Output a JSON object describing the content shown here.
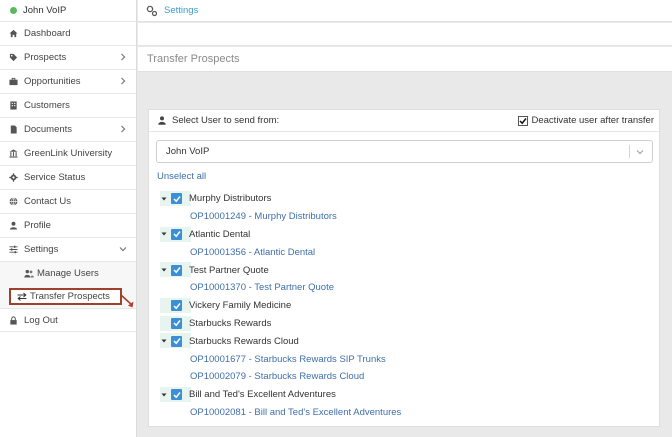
{
  "sidebar": {
    "user_name": "John VoIP",
    "status_color": "#5cb85c",
    "items": [
      {
        "label": "Dashboard",
        "icon": "home-icon"
      },
      {
        "label": "Prospects",
        "icon": "tag-icon",
        "chevron": "right"
      },
      {
        "label": "Opportunities",
        "icon": "briefcase-icon",
        "chevron": "right"
      },
      {
        "label": "Customers",
        "icon": "building-icon"
      },
      {
        "label": "Documents",
        "icon": "file-icon",
        "chevron": "right"
      },
      {
        "label": "GreenLink University",
        "icon": "university-icon"
      },
      {
        "label": "Service Status",
        "icon": "gear-icon"
      },
      {
        "label": "Contact Us",
        "icon": "globe-icon"
      },
      {
        "label": "Profile",
        "icon": "user-icon"
      },
      {
        "label": "Settings",
        "icon": "sliders-icon",
        "chevron": "down"
      }
    ],
    "sub_items": [
      {
        "label": "Manage Users",
        "icon": "users-icon"
      },
      {
        "label": "Transfer Prospects",
        "icon": "exchange-icon",
        "active": true
      }
    ],
    "logout_label": "Log Out"
  },
  "topbar": {
    "breadcrumb": "Settings",
    "icon": "settings-cogs-icon"
  },
  "page": {
    "title": "Transfer Prospects"
  },
  "panel": {
    "select_user_label": "Select User to send from:",
    "deactivate_label": "Deactivate user after transfer",
    "deactivate_checked": true,
    "selected_user": "John VoIP",
    "unselect_all": "Unselect all",
    "accent_color": "#3a8fd5",
    "link_color": "#3f6fa9",
    "prospects": [
      {
        "name": "Murphy Distributors",
        "expanded": true,
        "checked": true,
        "opportunities": [
          "OP10001249 - Murphy Distributors"
        ]
      },
      {
        "name": "Atlantic Dental",
        "expanded": true,
        "checked": true,
        "opportunities": [
          "OP10001356 - Atlantic Dental"
        ]
      },
      {
        "name": "Test Partner Quote",
        "expanded": true,
        "checked": true,
        "opportunities": [
          "OP10001370 - Test Partner Quote"
        ]
      },
      {
        "name": "Vickery Family Medicine",
        "expanded": false,
        "checked": true,
        "opportunities": []
      },
      {
        "name": "Starbucks Rewards",
        "expanded": false,
        "checked": true,
        "opportunities": []
      },
      {
        "name": "Starbucks Rewards Cloud",
        "expanded": true,
        "checked": true,
        "opportunities": [
          "OP10001677 - Starbucks Rewards SIP Trunks",
          "OP10002079 - Starbucks Rewards Cloud"
        ]
      },
      {
        "name": "Bill and Ted's Excellent Adventures",
        "expanded": true,
        "checked": true,
        "opportunities": [
          "OP10002081 - Bill and Ted's Excellent Adventures"
        ]
      }
    ]
  }
}
